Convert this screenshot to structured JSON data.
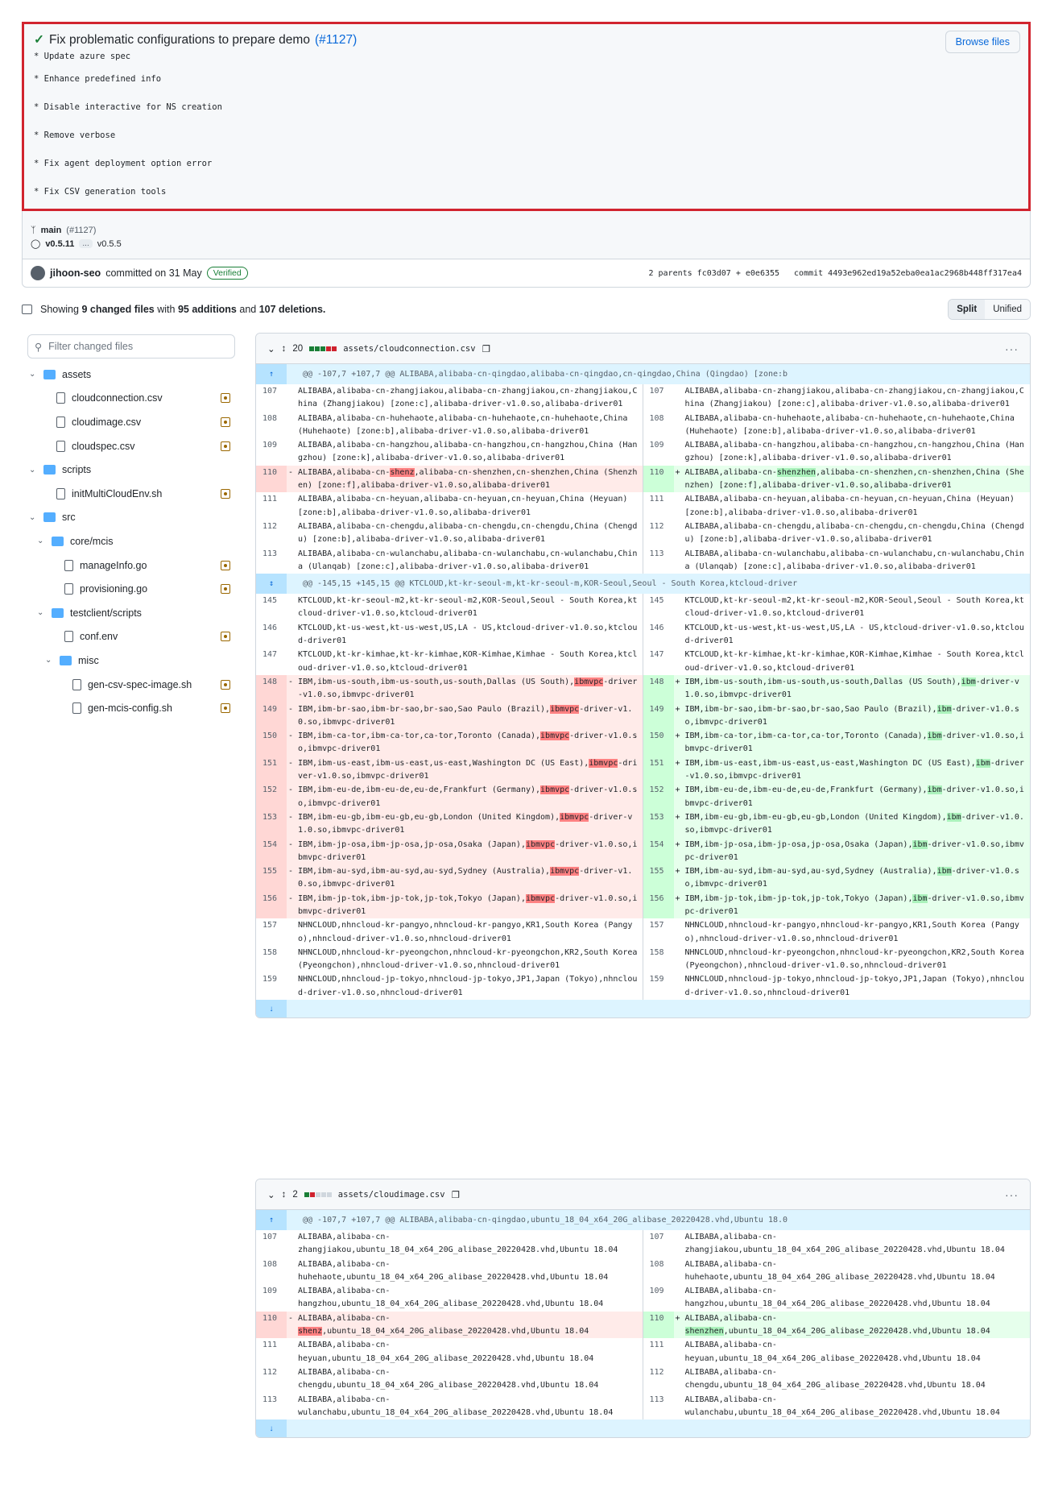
{
  "commit": {
    "title": "Fix problematic configurations to prepare demo",
    "pr_ref": "(#1127)",
    "message_lines": [
      "* Update azure spec",
      "* Enhance predefined info",
      "* Disable interactive for NS creation",
      "* Remove verbose",
      "* Fix agent deployment option error",
      "* Fix CSV generation tools"
    ],
    "browse_label": "Browse files",
    "branch": "main",
    "branch_pr": "(#1127)",
    "tag_from": "v0.5.11",
    "tag_ellipsis": "...",
    "tag_to": "v0.5.5",
    "author": "jihoon-seo",
    "committed_text": "committed on 31 May",
    "verified": "Verified",
    "parents": "2 parents fc03d07 + e0e6355",
    "commit_sha": "commit 4493e962ed19a52eba0ea1ac2968b448ff317ea4"
  },
  "summary": {
    "prefix": "Showing",
    "files_count": "9 changed files",
    "with": "with",
    "additions": "95 additions",
    "and": "and",
    "deletions": "107 deletions.",
    "split": "Split",
    "unified": "Unified"
  },
  "sidebar": {
    "filter_placeholder": "Filter changed files",
    "tree": [
      {
        "label": "assets",
        "type": "folder",
        "depth": 0
      },
      {
        "label": "cloudconnection.csv",
        "type": "file",
        "depth": 1
      },
      {
        "label": "cloudimage.csv",
        "type": "file",
        "depth": 1
      },
      {
        "label": "cloudspec.csv",
        "type": "file",
        "depth": 1
      },
      {
        "label": "scripts",
        "type": "folder",
        "depth": 0
      },
      {
        "label": "initMultiCloudEnv.sh",
        "type": "file",
        "depth": 1
      },
      {
        "label": "src",
        "type": "folder",
        "depth": 0
      },
      {
        "label": "core/mcis",
        "type": "folder",
        "depth": 1
      },
      {
        "label": "manageInfo.go",
        "type": "file",
        "depth": 2
      },
      {
        "label": "provisioning.go",
        "type": "file",
        "depth": 2
      },
      {
        "label": "testclient/scripts",
        "type": "folder",
        "depth": 1
      },
      {
        "label": "conf.env",
        "type": "file",
        "depth": 2
      },
      {
        "label": "misc",
        "type": "folder",
        "depth": 2
      },
      {
        "label": "gen-csv-spec-image.sh",
        "type": "file",
        "depth": 3
      },
      {
        "label": "gen-mcis-config.sh",
        "type": "file",
        "depth": 3
      }
    ]
  },
  "files": [
    {
      "count": "20",
      "stat": [
        "g",
        "g",
        "g",
        "r",
        "r"
      ],
      "path": "assets/cloudconnection.csv",
      "blocks": [
        {
          "hunk": "@@ -107,7 +107,7 @@ ALIBABA,alibaba-cn-qingdao,alibaba-cn-qingdao,cn-qingdao,China (Qingdao) [zone:b",
          "exp": "up",
          "rows": [
            {
              "t": "ctx",
              "ln": "107",
              "rn": "107",
              "l": "ALIBABA,alibaba-cn-zhangjiakou,alibaba-cn-zhangjiakou,cn-zhangjiakou,China (Zhangjiakou) [zone:c],alibaba-driver-v1.0.so,alibaba-driver01",
              "r": "ALIBABA,alibaba-cn-zhangjiakou,alibaba-cn-zhangjiakou,cn-zhangjiakou,China (Zhangjiakou) [zone:c],alibaba-driver-v1.0.so,alibaba-driver01"
            },
            {
              "t": "ctx",
              "ln": "108",
              "rn": "108",
              "l": "ALIBABA,alibaba-cn-huhehaote,alibaba-cn-huhehaote,cn-huhehaote,China (Huhehaote) [zone:b],alibaba-driver-v1.0.so,alibaba-driver01",
              "r": "ALIBABA,alibaba-cn-huhehaote,alibaba-cn-huhehaote,cn-huhehaote,China (Huhehaote) [zone:b],alibaba-driver-v1.0.so,alibaba-driver01"
            },
            {
              "t": "ctx",
              "ln": "109",
              "rn": "109",
              "l": "ALIBABA,alibaba-cn-hangzhou,alibaba-cn-hangzhou,cn-hangzhou,China (Hangzhou) [zone:k],alibaba-driver-v1.0.so,alibaba-driver01",
              "r": "ALIBABA,alibaba-cn-hangzhou,alibaba-cn-hangzhou,cn-hangzhou,China (Hangzhou) [zone:k],alibaba-driver-v1.0.so,alibaba-driver01"
            },
            {
              "t": "chg",
              "ln": "110",
              "rn": "110",
              "l": [
                "ALIBABA,alibaba-cn-",
                "shenz",
                ",alibaba-cn-shenzhen,cn-shenzhen,China (Shenzhen) [zone:f],alibaba-driver-v1.0.so,alibaba-driver01"
              ],
              "r": [
                "ALIBABA,alibaba-cn-",
                "shenzhen",
                ",alibaba-cn-shenzhen,cn-shenzhen,China (Shenzhen) [zone:f],alibaba-driver-v1.0.so,alibaba-driver01"
              ]
            },
            {
              "t": "ctx",
              "ln": "111",
              "rn": "111",
              "l": "ALIBABA,alibaba-cn-heyuan,alibaba-cn-heyuan,cn-heyuan,China (Heyuan) [zone:b],alibaba-driver-v1.0.so,alibaba-driver01",
              "r": "ALIBABA,alibaba-cn-heyuan,alibaba-cn-heyuan,cn-heyuan,China (Heyuan) [zone:b],alibaba-driver-v1.0.so,alibaba-driver01"
            },
            {
              "t": "ctx",
              "ln": "112",
              "rn": "112",
              "l": "ALIBABA,alibaba-cn-chengdu,alibaba-cn-chengdu,cn-chengdu,China (Chengdu) [zone:b],alibaba-driver-v1.0.so,alibaba-driver01",
              "r": "ALIBABA,alibaba-cn-chengdu,alibaba-cn-chengdu,cn-chengdu,China (Chengdu) [zone:b],alibaba-driver-v1.0.so,alibaba-driver01"
            },
            {
              "t": "ctx",
              "ln": "113",
              "rn": "113",
              "l": "ALIBABA,alibaba-cn-wulanchabu,alibaba-cn-wulanchabu,cn-wulanchabu,China (Ulanqab) [zone:c],alibaba-driver-v1.0.so,alibaba-driver01",
              "r": "ALIBABA,alibaba-cn-wulanchabu,alibaba-cn-wulanchabu,cn-wulanchabu,China (Ulanqab) [zone:c],alibaba-driver-v1.0.so,alibaba-driver01"
            }
          ]
        },
        {
          "hunk": "@@ -145,15 +145,15 @@ KTCLOUD,kt-kr-seoul-m,kt-kr-seoul-m,KOR-Seoul,Seoul - South Korea,ktcloud-driver",
          "exp": "both",
          "rows": [
            {
              "t": "ctx",
              "ln": "145",
              "rn": "145",
              "l": "KTCLOUD,kt-kr-seoul-m2,kt-kr-seoul-m2,KOR-Seoul,Seoul - South Korea,ktcloud-driver-v1.0.so,ktcloud-driver01",
              "r": "KTCLOUD,kt-kr-seoul-m2,kt-kr-seoul-m2,KOR-Seoul,Seoul - South Korea,ktcloud-driver-v1.0.so,ktcloud-driver01"
            },
            {
              "t": "ctx",
              "ln": "146",
              "rn": "146",
              "l": "KTCLOUD,kt-us-west,kt-us-west,US,LA - US,ktcloud-driver-v1.0.so,ktcloud-driver01",
              "r": "KTCLOUD,kt-us-west,kt-us-west,US,LA - US,ktcloud-driver-v1.0.so,ktcloud-driver01"
            },
            {
              "t": "ctx",
              "ln": "147",
              "rn": "147",
              "l": "KTCLOUD,kt-kr-kimhae,kt-kr-kimhae,KOR-Kimhae,Kimhae - South Korea,ktcloud-driver-v1.0.so,ktcloud-driver01",
              "r": "KTCLOUD,kt-kr-kimhae,kt-kr-kimhae,KOR-Kimhae,Kimhae - South Korea,ktcloud-driver-v1.0.so,ktcloud-driver01"
            },
            {
              "t": "chg",
              "ln": "148",
              "rn": "148",
              "l": [
                "IBM,ibm-us-south,ibm-us-south,us-south,Dallas (US South),",
                "ibmvpc",
                "-driver-v1.0.so,ibmvpc-driver01"
              ],
              "r": [
                "IBM,ibm-us-south,ibm-us-south,us-south,Dallas (US South),",
                "ibm",
                "-driver-v1.0.so,ibmvpc-driver01"
              ]
            },
            {
              "t": "chg",
              "ln": "149",
              "rn": "149",
              "l": [
                "IBM,ibm-br-sao,ibm-br-sao,br-sao,Sao Paulo (Brazil),",
                "ibmvpc",
                "-driver-v1.0.so,ibmvpc-driver01"
              ],
              "r": [
                "IBM,ibm-br-sao,ibm-br-sao,br-sao,Sao Paulo (Brazil),",
                "ibm",
                "-driver-v1.0.so,ibmvpc-driver01"
              ]
            },
            {
              "t": "chg",
              "ln": "150",
              "rn": "150",
              "l": [
                "IBM,ibm-ca-tor,ibm-ca-tor,ca-tor,Toronto (Canada),",
                "ibmvpc",
                "-driver-v1.0.so,ibmvpc-driver01"
              ],
              "r": [
                "IBM,ibm-ca-tor,ibm-ca-tor,ca-tor,Toronto (Canada),",
                "ibm",
                "-driver-v1.0.so,ibmvpc-driver01"
              ]
            },
            {
              "t": "chg",
              "ln": "151",
              "rn": "151",
              "l": [
                "IBM,ibm-us-east,ibm-us-east,us-east,Washington DC (US East),",
                "ibmvpc",
                "-driver-v1.0.so,ibmvpc-driver01"
              ],
              "r": [
                "IBM,ibm-us-east,ibm-us-east,us-east,Washington DC (US East),",
                "ibm",
                "-driver-v1.0.so,ibmvpc-driver01"
              ]
            },
            {
              "t": "chg",
              "ln": "152",
              "rn": "152",
              "l": [
                "IBM,ibm-eu-de,ibm-eu-de,eu-de,Frankfurt (Germany),",
                "ibmvpc",
                "-driver-v1.0.so,ibmvpc-driver01"
              ],
              "r": [
                "IBM,ibm-eu-de,ibm-eu-de,eu-de,Frankfurt (Germany),",
                "ibm",
                "-driver-v1.0.so,ibmvpc-driver01"
              ]
            },
            {
              "t": "chg",
              "ln": "153",
              "rn": "153",
              "l": [
                "IBM,ibm-eu-gb,ibm-eu-gb,eu-gb,London (United Kingdom),",
                "ibmvpc",
                "-driver-v1.0.so,ibmvpc-driver01"
              ],
              "r": [
                "IBM,ibm-eu-gb,ibm-eu-gb,eu-gb,London (United Kingdom),",
                "ibm",
                "-driver-v1.0.so,ibmvpc-driver01"
              ]
            },
            {
              "t": "chg",
              "ln": "154",
              "rn": "154",
              "l": [
                "IBM,ibm-jp-osa,ibm-jp-osa,jp-osa,Osaka (Japan),",
                "ibmvpc",
                "-driver-v1.0.so,ibmvpc-driver01"
              ],
              "r": [
                "IBM,ibm-jp-osa,ibm-jp-osa,jp-osa,Osaka (Japan),",
                "ibm",
                "-driver-v1.0.so,ibmvpc-driver01"
              ]
            },
            {
              "t": "chg",
              "ln": "155",
              "rn": "155",
              "l": [
                "IBM,ibm-au-syd,ibm-au-syd,au-syd,Sydney (Australia),",
                "ibmvpc",
                "-driver-v1.0.so,ibmvpc-driver01"
              ],
              "r": [
                "IBM,ibm-au-syd,ibm-au-syd,au-syd,Sydney (Australia),",
                "ibm",
                "-driver-v1.0.so,ibmvpc-driver01"
              ]
            },
            {
              "t": "chg",
              "ln": "156",
              "rn": "156",
              "l": [
                "IBM,ibm-jp-tok,ibm-jp-tok,jp-tok,Tokyo (Japan),",
                "ibmvpc",
                "-driver-v1.0.so,ibmvpc-driver01"
              ],
              "r": [
                "IBM,ibm-jp-tok,ibm-jp-tok,jp-tok,Tokyo (Japan),",
                "ibm",
                "-driver-v1.0.so,ibmvpc-driver01"
              ]
            },
            {
              "t": "ctx",
              "ln": "157",
              "rn": "157",
              "l": "NHNCLOUD,nhncloud-kr-pangyo,nhncloud-kr-pangyo,KR1,South Korea (Pangyo),nhncloud-driver-v1.0.so,nhncloud-driver01",
              "r": "NHNCLOUD,nhncloud-kr-pangyo,nhncloud-kr-pangyo,KR1,South Korea (Pangyo),nhncloud-driver-v1.0.so,nhncloud-driver01"
            },
            {
              "t": "ctx",
              "ln": "158",
              "rn": "158",
              "l": "NHNCLOUD,nhncloud-kr-pyeongchon,nhncloud-kr-pyeongchon,KR2,South Korea (Pyeongchon),nhncloud-driver-v1.0.so,nhncloud-driver01",
              "r": "NHNCLOUD,nhncloud-kr-pyeongchon,nhncloud-kr-pyeongchon,KR2,South Korea (Pyeongchon),nhncloud-driver-v1.0.so,nhncloud-driver01"
            },
            {
              "t": "ctx",
              "ln": "159",
              "rn": "159",
              "l": "NHNCLOUD,nhncloud-jp-tokyo,nhncloud-jp-tokyo,JP1,Japan (Tokyo),nhncloud-driver-v1.0.so,nhncloud-driver01",
              "r": "NHNCLOUD,nhncloud-jp-tokyo,nhncloud-jp-tokyo,JP1,Japan (Tokyo),nhncloud-driver-v1.0.so,nhncloud-driver01"
            }
          ]
        }
      ]
    },
    {
      "count": "2",
      "stat": [
        "g",
        "r",
        "n",
        "n",
        "n"
      ],
      "path": "assets/cloudimage.csv",
      "blocks": [
        {
          "hunk": "@@ -107,7 +107,7 @@ ALIBABA,alibaba-cn-qingdao,ubuntu_18_04_x64_20G_alibase_20220428.vhd,Ubuntu 18.0",
          "exp": "up",
          "rows": [
            {
              "t": "ctx",
              "ln": "107",
              "rn": "107",
              "l": "ALIBABA,alibaba-cn-\nzhangjiakou,ubuntu_18_04_x64_20G_alibase_20220428.vhd,Ubuntu 18.04",
              "r": "ALIBABA,alibaba-cn-\nzhangjiakou,ubuntu_18_04_x64_20G_alibase_20220428.vhd,Ubuntu 18.04"
            },
            {
              "t": "ctx",
              "ln": "108",
              "rn": "108",
              "l": "ALIBABA,alibaba-cn-\nhuhehaote,ubuntu_18_04_x64_20G_alibase_20220428.vhd,Ubuntu 18.04",
              "r": "ALIBABA,alibaba-cn-\nhuhehaote,ubuntu_18_04_x64_20G_alibase_20220428.vhd,Ubuntu 18.04"
            },
            {
              "t": "ctx",
              "ln": "109",
              "rn": "109",
              "l": "ALIBABA,alibaba-cn-\nhangzhou,ubuntu_18_04_x64_20G_alibase_20220428.vhd,Ubuntu 18.04",
              "r": "ALIBABA,alibaba-cn-\nhangzhou,ubuntu_18_04_x64_20G_alibase_20220428.vhd,Ubuntu 18.04"
            },
            {
              "t": "chg",
              "ln": "110",
              "rn": "110",
              "l": [
                "ALIBABA,alibaba-cn-\n",
                "shenz",
                ",ubuntu_18_04_x64_20G_alibase_20220428.vhd,Ubuntu 18.04"
              ],
              "r": [
                "ALIBABA,alibaba-cn-\n",
                "shenzhen",
                ",ubuntu_18_04_x64_20G_alibase_20220428.vhd,Ubuntu 18.04"
              ]
            },
            {
              "t": "ctx",
              "ln": "111",
              "rn": "111",
              "l": "ALIBABA,alibaba-cn-\nheyuan,ubuntu_18_04_x64_20G_alibase_20220428.vhd,Ubuntu 18.04",
              "r": "ALIBABA,alibaba-cn-\nheyuan,ubuntu_18_04_x64_20G_alibase_20220428.vhd,Ubuntu 18.04"
            },
            {
              "t": "ctx",
              "ln": "112",
              "rn": "112",
              "l": "ALIBABA,alibaba-cn-\nchengdu,ubuntu_18_04_x64_20G_alibase_20220428.vhd,Ubuntu 18.04",
              "r": "ALIBABA,alibaba-cn-\nchengdu,ubuntu_18_04_x64_20G_alibase_20220428.vhd,Ubuntu 18.04"
            },
            {
              "t": "ctx",
              "ln": "113",
              "rn": "113",
              "l": "ALIBABA,alibaba-cn-\nwulanchabu,ubuntu_18_04_x64_20G_alibase_20220428.vhd,Ubuntu 18.04",
              "r": "ALIBABA,alibaba-cn-\nwulanchabu,ubuntu_18_04_x64_20G_alibase_20220428.vhd,Ubuntu 18.04"
            }
          ]
        }
      ]
    }
  ]
}
